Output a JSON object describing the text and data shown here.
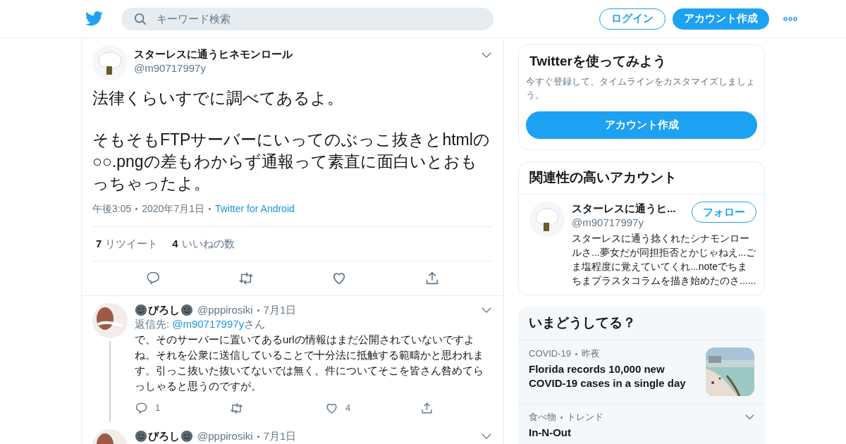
{
  "header": {
    "search": {
      "placeholder": "キーワード検索"
    },
    "login_button": "ログイン",
    "signup_button": "アカウント作成"
  },
  "tweet": {
    "author": "スターレスに通うヒネモンロール",
    "handle": "@m90717997y",
    "paragraphs": [
      "法律くらいすでに調べてあるよ。",
      "そもそもFTPサーバーにいってのぶっこ抜きとhtmlの○○.pngの差もわからず通報って素直に面白いとおもっちゃったよ。"
    ],
    "time": "午後3:05",
    "date": "2020年7月1日",
    "source": "Twitter for Android",
    "stats": [
      {
        "count": "7",
        "label": "リツイート"
      },
      {
        "count": "4",
        "label": "いいねの数"
      }
    ]
  },
  "replies": [
    {
      "name": "ぴろし",
      "handle": "@pppirosiki",
      "date": "7月1日",
      "reply_to_label": "返信先:",
      "reply_to_handle": "@m90717997y",
      "reply_to_suffix": "さん",
      "text": "で、そのサーバーに置いてあるurlの情報はまだ公開されていないですよね。それを公衆に送信していることで十分法に抵触する範疇かと思われます。引っこ抜いた抜いてないでは無く、件についてそこを皆さん咎めてらっしゃると思うのですが。",
      "reply_count": "1",
      "like_count": "4"
    },
    {
      "name": "ぴろし",
      "handle": "@pppirosiki",
      "date": "7月1日"
    }
  ],
  "sidebar": {
    "signup_card": {
      "title": "Twitterを使ってみよう",
      "subtitle": "今すぐ登録して、タイムラインをカスタマイズしましょう。",
      "button": "アカウント作成"
    },
    "suggestions": {
      "title": "関連性の高いアカウント",
      "accounts": [
        {
          "name": "スターレスに通うヒ...",
          "handle": "@m90717997y",
          "bio": "スターレスに通う捻くれたシナモンロールさ...夢女だが同担拒否とかじゃねえ...ごま塩程度に覚えていてくれ...noteでちまちまプラスタコラムを描き始めたのさ......",
          "button": "フォロー"
        }
      ]
    },
    "trends": {
      "title": "いまどうしてる？",
      "items": [
        {
          "kind": "news",
          "category": "COVID-19",
          "time": "昨夜",
          "headline": "Florida records 10,000 new COVID-19 cases in a single day"
        },
        {
          "kind": "trend",
          "category": "食べ物",
          "time": "トレンド",
          "headline": "In-N-Out"
        }
      ]
    }
  }
}
